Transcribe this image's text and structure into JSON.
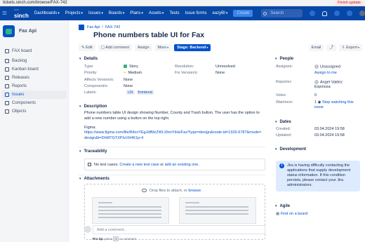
{
  "browser": {
    "url": "tickets.sinch.com/browse/FAX-742",
    "finish_update": "Finish update"
  },
  "topnav": {
    "brand_top": "~~",
    "brand_name": "sinch",
    "items": [
      "Dashboards",
      "Projects",
      "Issues",
      "Boards",
      "Plans",
      "Assets",
      "Tests",
      "Issue forms",
      "eazyBI"
    ],
    "create": "Create",
    "search_placeholder": "Search"
  },
  "sidebar": {
    "project_name": "Fax Api",
    "items": [
      {
        "label": "FAX board",
        "active": false
      },
      {
        "label": "Backlog",
        "active": false
      },
      {
        "label": "Kanban board",
        "active": false
      },
      {
        "label": "Releases",
        "active": false
      },
      {
        "label": "Reports",
        "active": false
      },
      {
        "label": "Issues",
        "active": true
      },
      {
        "label": "Components",
        "active": false
      },
      {
        "label": "Objects",
        "active": false
      }
    ]
  },
  "breadcrumb": {
    "project": "Fax Api",
    "issue_key": "FAX-742"
  },
  "issue": {
    "title": "Phone numbers table UI for Fax"
  },
  "toolbar": {
    "edit": "Edit",
    "add_comment": "Add comment",
    "assign": "Assign",
    "more": "More",
    "stage": "Stage: Backend",
    "email": "Email",
    "export": "Export"
  },
  "details": {
    "heading": "Details",
    "type_label": "Type:",
    "type_value": "Story",
    "priority_label": "Priority:",
    "priority_value": "Medium",
    "affects_label": "Affects Version/s:",
    "affects_value": "None",
    "components_label": "Component/s:",
    "components_value": "None",
    "labels_label": "Labels:",
    "labels": [
      "UX",
      "frontend"
    ],
    "resolution_label": "Resolution:",
    "resolution_value": "Unresolved",
    "fix_label": "Fix Version/s:",
    "fix_value": "None"
  },
  "description": {
    "heading": "Description",
    "text": "Phone numbers table UI design showing Number, County and Trash button. The user has the option to add a new number using a button on the top right.",
    "figma_label": "Figma:",
    "figma_link": "https://www.figma.com/file/B4xvYEgJdfMz2WLXhmYiHs/Fax?type=design&node-id=1329-6787&mode=design&t=DhMTGTXPIsVH4K1p-4"
  },
  "traceability": {
    "heading": "Traceability",
    "text_before": "No test cases.",
    "create_link": "Create a new test case",
    "middle": "or",
    "existing_link": "add an existing one."
  },
  "attachments": {
    "heading": "Attachments",
    "drop_text": "Drop files to attach, or",
    "browse": "browse."
  },
  "comment": {
    "placeholder": "Add a comment...",
    "protip_label": "Pro tip:",
    "protip_press": "press",
    "protip_key": "m",
    "protip_end": "to comment"
  },
  "people": {
    "heading": "People",
    "assignee_label": "Assignee:",
    "assignee_value": "Unassigned",
    "assign_me": "Assign to me",
    "reporter_label": "Reporter:",
    "reporter_value": "Angel Valdez Espinoza",
    "votes_label": "Votes:",
    "votes_value": "0",
    "watchers_label": "Watchers:",
    "watchers_value": "1",
    "stop_watching": "Stop watching this issue"
  },
  "dates": {
    "heading": "Dates",
    "created_label": "Created:",
    "created_value": "03.04.2024 19:58",
    "updated_label": "Updated:",
    "updated_value": "03.04.2024 19:58"
  },
  "development": {
    "heading": "Development",
    "notice": "Jira is having difficulty contacting the applications that supply development status information. If this condition persists, please contact your Jira administrators."
  },
  "agile": {
    "heading": "Agile",
    "find_board": "Find on a board"
  },
  "colors": {
    "nav": "#0747a6",
    "accent": "#0052cc",
    "story": "#36b37e",
    "info_bg": "#deebff"
  }
}
